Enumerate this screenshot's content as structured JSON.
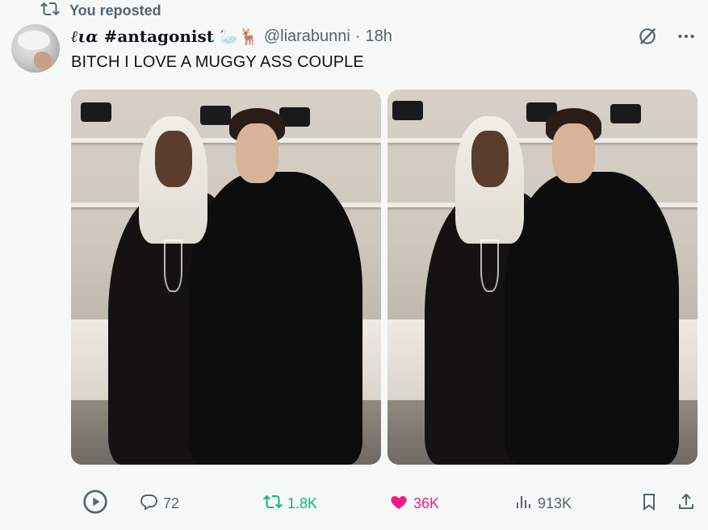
{
  "repost": {
    "label": "You reposted"
  },
  "author": {
    "display_name_script": "ℓια",
    "display_name_rest": "#antagonist",
    "emojis": "🦢🦌",
    "handle": "@liarabunni",
    "separator": "·",
    "time": "18h"
  },
  "tweet": {
    "text": "BITCH I LOVE A MUGGY ASS COUPLE"
  },
  "icons": {
    "repost": "repost-icon",
    "grok": "grok-icon",
    "more": "more-icon",
    "play": "play-icon",
    "reply": "reply-icon",
    "like": "heart-icon",
    "views": "views-icon",
    "bookmark": "bookmark-icon",
    "share": "share-icon"
  },
  "actions": {
    "replies": "72",
    "reposts": "1.8K",
    "likes": "36K",
    "views": "913K"
  },
  "colors": {
    "muted": "#536471",
    "repost_active": "#00ba7c",
    "like_active": "#f91880",
    "background": "#f7f9f9"
  }
}
